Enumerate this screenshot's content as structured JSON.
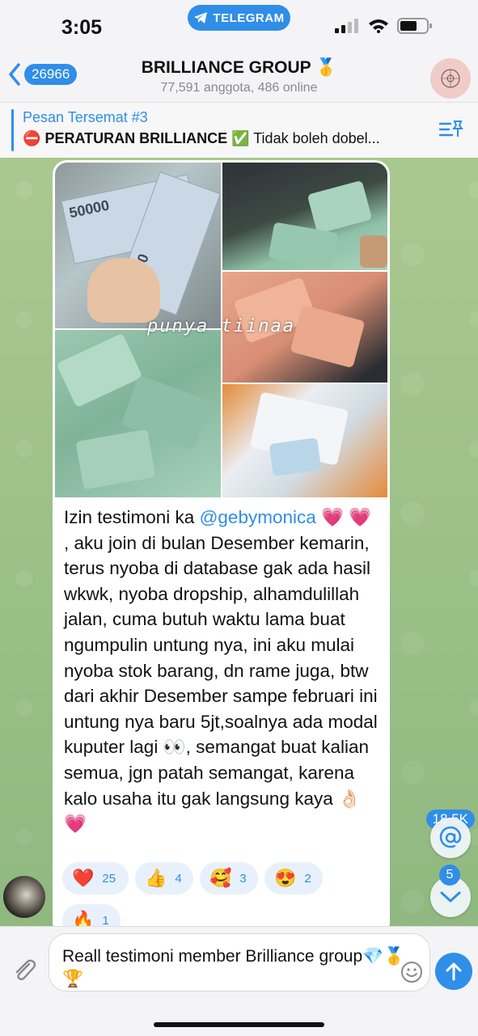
{
  "status": {
    "time": "3:05",
    "app_pill": "TELEGRAM"
  },
  "header": {
    "back_count": "26966",
    "title": "BRILLIANCE GROUP 🥇",
    "subtitle": "77,591 anggota, 486 online"
  },
  "pinned": {
    "title": "Pesan Tersemat #3",
    "icon_emoji": "⛔",
    "bold_text": "PERATURAN BRILLIANCE",
    "check_emoji": "✅",
    "rest_text": "Tidak boleh dobel..."
  },
  "message": {
    "image_watermark": "punya tiinaa",
    "money_label": "50000",
    "text_before": "Izin testimoni ka ",
    "mention": "@gebymonica",
    "text_after": " 💗 💗 , aku join di bulan Desember kemarin, terus nyoba di database gak ada hasil wkwk, nyoba dropship, alhamdulillah jalan, cuma butuh waktu lama buat ngumpulin untung nya, ini aku mulai nyoba stok barang, dn rame juga, btw dari akhir Desember sampe februari ini untung nya baru 5jt,soalnya ada modal kuputer lagi 👀, semangat buat kalian semua, jgn patah semangat, karena kalo usaha itu gak langsung kaya 👌🏻 💗",
    "reactions": [
      {
        "emoji": "❤️",
        "count": "25"
      },
      {
        "emoji": "👍",
        "count": "4"
      },
      {
        "emoji": "🥰",
        "count": "3"
      },
      {
        "emoji": "😍",
        "count": "2"
      },
      {
        "emoji": "🔥",
        "count": "1"
      }
    ]
  },
  "floating": {
    "mentions_count": "18.5K",
    "unread_count": "5"
  },
  "composer": {
    "text": "Reall testimoni member Brilliance group💎🥇🏆"
  },
  "colors": {
    "accent": "#2f8ee8",
    "chat_bg": "#9fc28c"
  }
}
